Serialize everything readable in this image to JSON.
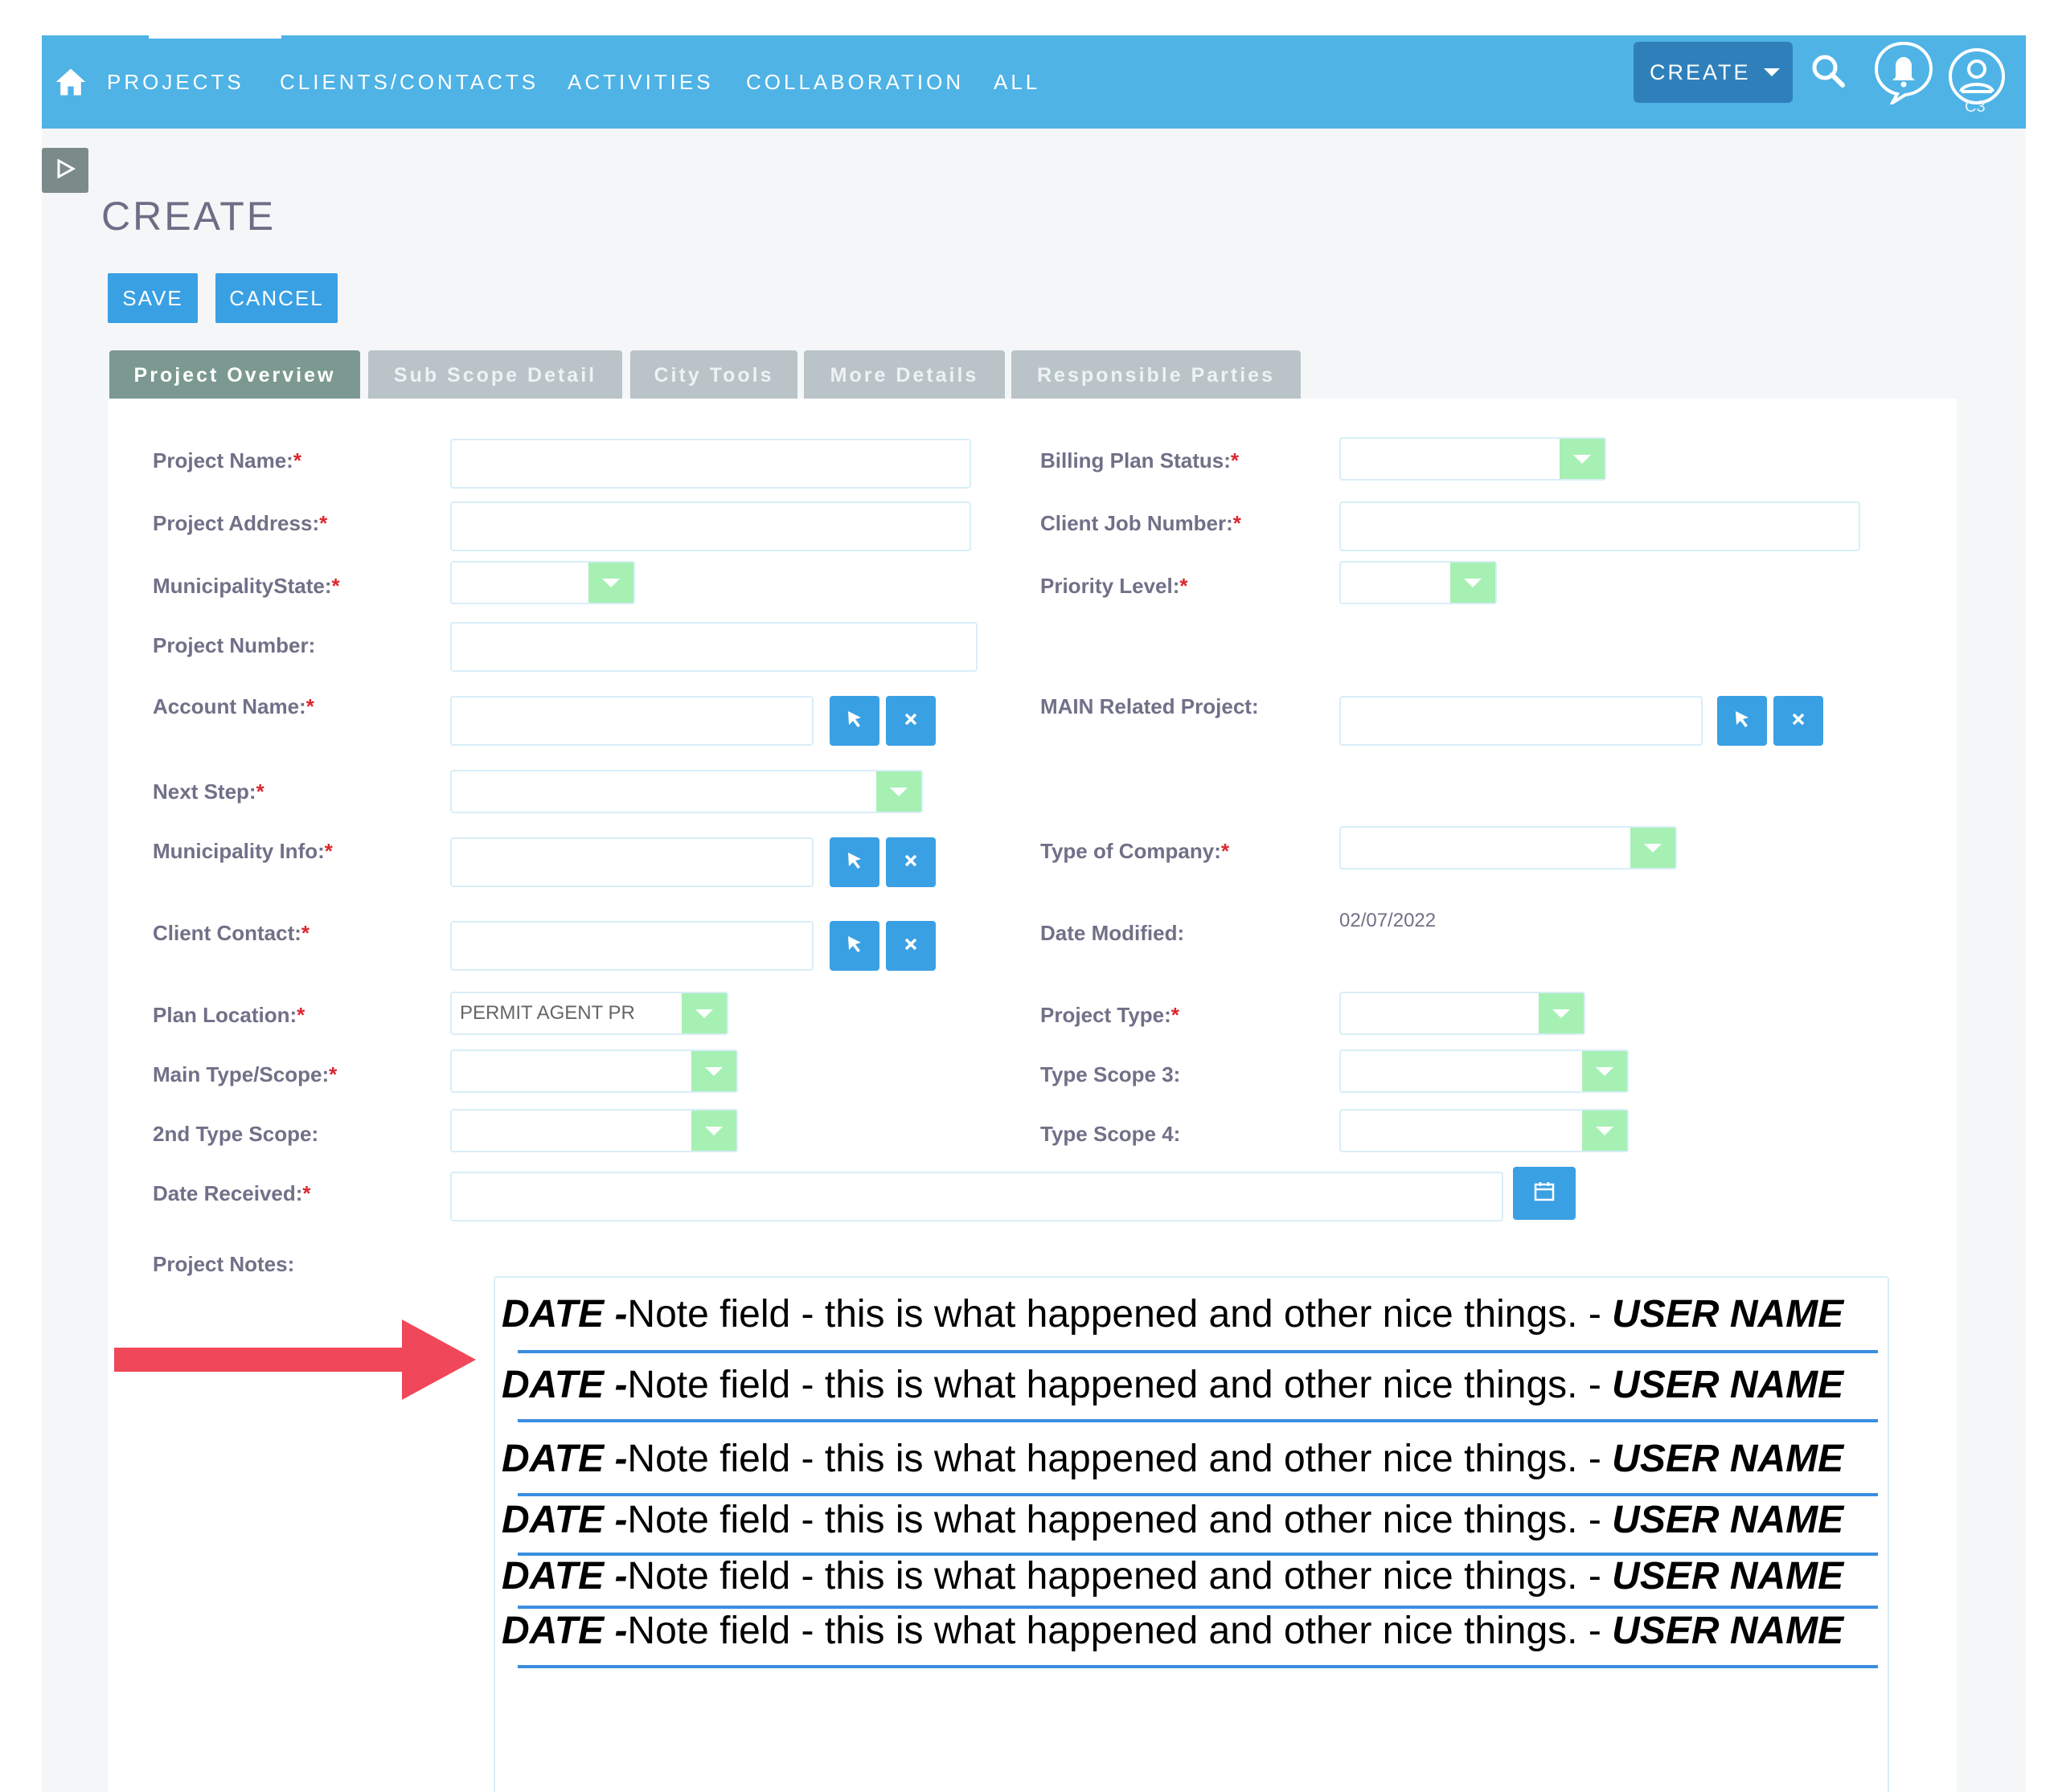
{
  "nav": {
    "items": [
      "PROJECTS",
      "CLIENTS/CONTACTS",
      "ACTIVITIES",
      "COLLABORATION",
      "ALL"
    ],
    "create_label": "CREATE",
    "user_initials": "C3"
  },
  "page": {
    "title": "CREATE",
    "save_label": "SAVE",
    "cancel_label": "CANCEL"
  },
  "tabs": [
    "Project Overview",
    "Sub Scope Detail",
    "City Tools",
    "More Details",
    "Responsible Parties"
  ],
  "active_tab": "Project Overview",
  "fields": {
    "project_name": "Project Name:",
    "project_address": "Project Address:",
    "municipality_state": "MunicipalityState:",
    "project_number": "Project Number:",
    "account_name": "Account Name:",
    "next_step": "Next Step:",
    "municipality_info": "Municipality Info:",
    "client_contact": "Client Contact:",
    "plan_location": "Plan Location:",
    "main_type_scope": "Main Type/Scope:",
    "second_type_scope": "2nd Type Scope:",
    "date_received": "Date Received:",
    "project_notes": "Project Notes:",
    "billing_plan_status": "Billing Plan Status:",
    "client_job_number": "Client Job Number:",
    "priority_level": "Priority Level:",
    "main_related_project": "MAIN Related Project:",
    "type_of_company": "Type of Company:",
    "date_modified": "Date Modified:",
    "project_type": "Project Type:",
    "type_scope_3": "Type Scope 3:",
    "type_scope_4": "Type Scope 4:"
  },
  "required_mark": "*",
  "values": {
    "plan_location": "PERMIT AGENT PR",
    "date_modified": "02/07/2022"
  },
  "notes": [
    {
      "date": "DATE -",
      "text": "Note field - this is what happened and other nice things. - ",
      "user": "USER NAME"
    },
    {
      "date": "DATE -",
      "text": "Note field - this is what happened and other nice things. - ",
      "user": "USER NAME"
    },
    {
      "date": "DATE -",
      "text": "Note field - this is what happened and other nice things. - ",
      "user": "USER NAME"
    },
    {
      "date": "DATE -",
      "text": "Note field - this is what happened and other nice things. - ",
      "user": "USER NAME"
    },
    {
      "date": "DATE -",
      "text": "Note field - this is what happened and other nice things. - ",
      "user": "USER NAME"
    },
    {
      "date": "DATE -",
      "text": "Note field - this is what happened and other nice things. - ",
      "user": "USER NAME"
    }
  ],
  "colors": {
    "nav": "#4fb3e6",
    "button": "#3aa0e4",
    "dropdown_arrow": "#a6f0b4",
    "required": "#d9282f",
    "annotation_arrow": "#f0475a",
    "note_rule": "#3a8ee0"
  },
  "icons": [
    "home-icon",
    "search-icon",
    "bell-icon",
    "user-icon",
    "caret-down-icon",
    "play-icon",
    "cursor-icon",
    "close-icon",
    "calendar-icon",
    "arrow-right-icon"
  ]
}
